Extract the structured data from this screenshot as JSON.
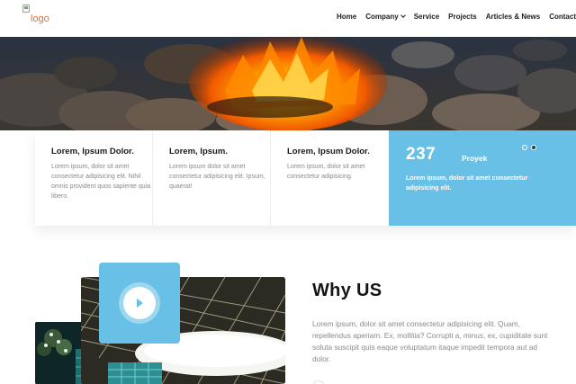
{
  "header": {
    "logo_alt": "logo",
    "nav": {
      "home": "Home",
      "company": "Company",
      "service": "Service",
      "projects": "Projects",
      "articles": "Articles & News",
      "contact": "Contact"
    }
  },
  "features": [
    {
      "title": "Lorem, Ipsum Dolor.",
      "text": "Lorem ipsum, dolor sit amet consectetur adipisicing elit. Nihil omnis provident quos sapiente quia libero."
    },
    {
      "title": "Lorem, Ipsum.",
      "text": "Lorem ipsum dolor sit amet consectetur adipisicing elit. Ipsum, quaerat!"
    },
    {
      "title": "Lorem, Ipsum Dolor.",
      "text": "Lorem ipsum, dolor sit amet consectetur adipisicing."
    }
  ],
  "stat": {
    "number": "237",
    "label": "Proyek",
    "text": "Lorem ipsum, dolor sit amet consectetur adipisicing elit."
  },
  "why": {
    "title": "Why US",
    "text": "Lorem ipsum, dolor sit amet consectetur adipisicing elit. Quam, repellendus aperiam. Ex, mollitia? Corrupti a, minus, ex, cupiditate sunt soluta suscipit quis eaque voluptatum itaque impedit tempora aut ad dolor."
  },
  "colors": {
    "accent": "#68c0e6",
    "logo": "#ef6d22"
  }
}
